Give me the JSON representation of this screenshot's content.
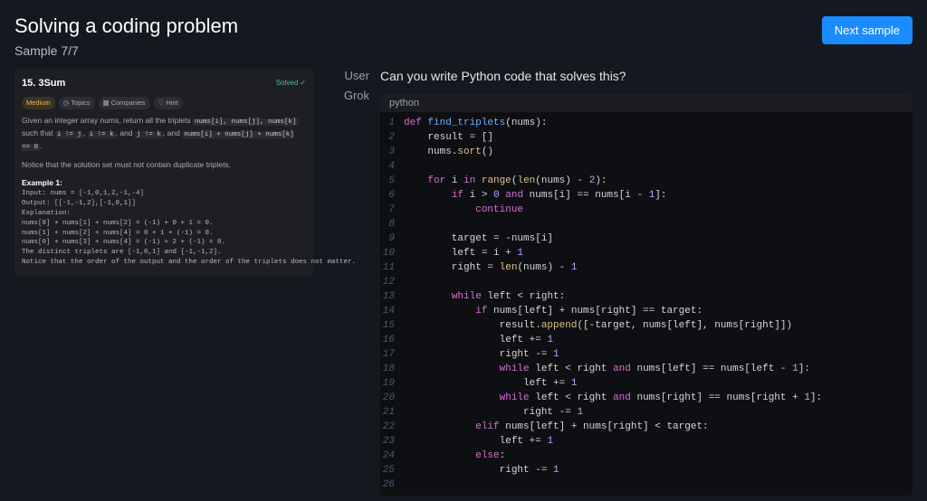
{
  "header": {
    "title": "Solving a coding problem",
    "sample": "Sample 7/7",
    "next_btn": "Next sample"
  },
  "problem": {
    "title": "15. 3Sum",
    "solved_label": "Solved",
    "chips": {
      "difficulty": "Medium",
      "topics": "Topics",
      "companies": "Companies",
      "hint": "Hint"
    },
    "desc_parts": {
      "p1a": "Given an integer array nums, return all the triplets ",
      "c1": "nums[i], nums[j], nums[k]",
      "p1b": " such that ",
      "c2": "i != j",
      "p1c": ", ",
      "c3": "i != k",
      "p1d": ", and ",
      "c4": "j != k",
      "p1e": ", and ",
      "c5": "nums[i] + nums[j] + nums[k] == 0",
      "p1f": ".",
      "p2": "Notice that the solution set must not contain duplicate triplets."
    },
    "example_label": "Example 1:",
    "example_block": "Input: nums = [-1,0,1,2,-1,-4]\nOutput: [[-1,-1,2],[-1,0,1]]\nExplanation:\nnums[0] + nums[1] + nums[2] = (-1) + 0 + 1 = 0.\nnums[1] + nums[2] + nums[4] = 0 + 1 + (-1) = 0.\nnums[0] + nums[3] + nums[4] = (-1) + 2 + (-1) = 0.\nThe distinct triplets are [-1,0,1] and [-1,-1,2].\nNotice that the order of the output and the order of the triplets does not matter."
  },
  "chat": {
    "user_label": "User",
    "assistant_label": "Grok",
    "user_msg": "Can you write Python code that solves this?",
    "code_lang": "python",
    "code_lines": {
      "l1": {
        "kw": "def",
        "fn": " find_triplets",
        "rest": "(nums):"
      },
      "l2": "    result = []",
      "l3": "    nums.sort()",
      "l4": "",
      "l5": {
        "pre": "    ",
        "kw": "for",
        "mid": " i ",
        "kw2": "in",
        "post": " range(len(nums) - 2):"
      },
      "l6": {
        "pre": "        ",
        "kw": "if",
        "post": " i > 0 and nums[i] == nums[i - 1]:"
      },
      "l7": {
        "pre": "            ",
        "kw": "continue"
      },
      "l8": "",
      "l9": "        target = -nums[i]",
      "l10": "        left = i + 1",
      "l11": "        right = len(nums) - 1",
      "l12": "",
      "l13": {
        "pre": "        ",
        "kw": "while",
        "post": " left < right:"
      },
      "l14": {
        "pre": "            ",
        "kw": "if",
        "post": " nums[left] + nums[right] == target:"
      },
      "l15": "                result.append([-target, nums[left], nums[right]])",
      "l16": "                left += 1",
      "l17": "                right -= 1",
      "l18": {
        "pre": "                ",
        "kw": "while",
        "post": " left < right and nums[left] == nums[left - 1]:"
      },
      "l19": "                    left += 1",
      "l20": {
        "pre": "                ",
        "kw": "while",
        "post": " left < right and nums[right] == nums[right + 1]:"
      },
      "l21": "                    right -= 1",
      "l22": {
        "pre": "            ",
        "kw": "elif",
        "post": " nums[left] + nums[right] < target:"
      },
      "l23": "                left += 1",
      "l24": {
        "pre": "            ",
        "kw": "else",
        "post": ":"
      },
      "l25": "                right -= 1",
      "l26": ""
    }
  }
}
